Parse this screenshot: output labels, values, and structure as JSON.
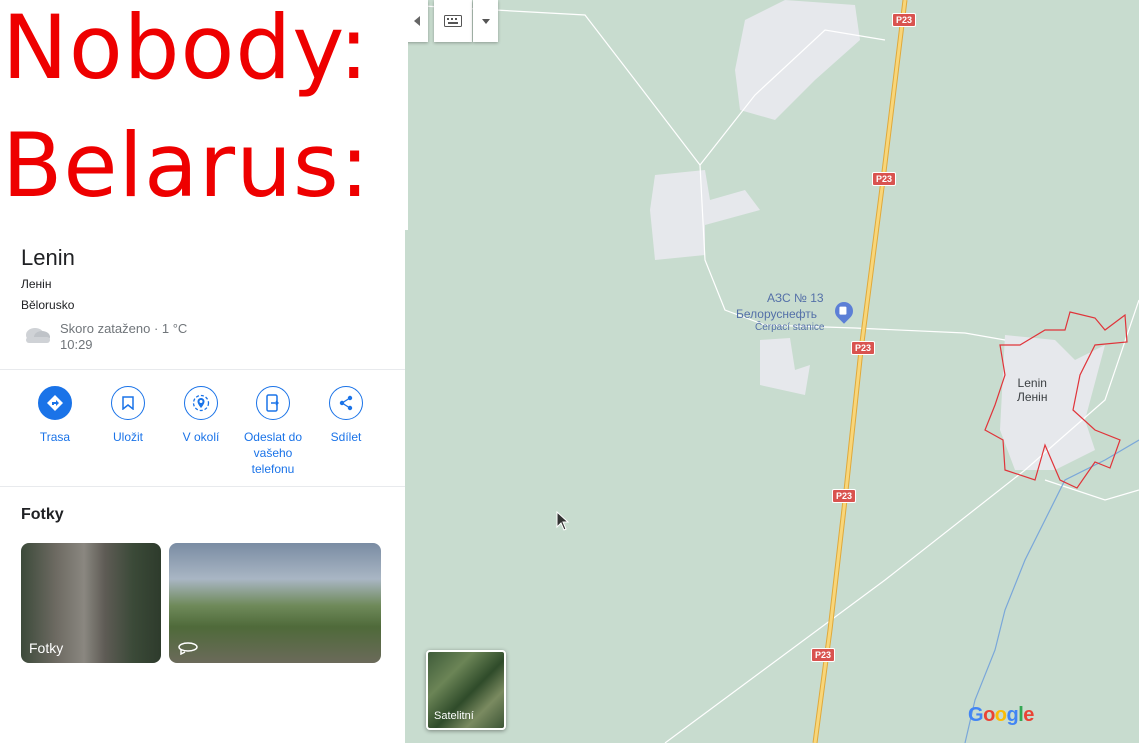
{
  "meme": {
    "line1": "Nobody:",
    "line2": "Belarus:"
  },
  "place": {
    "name": "Lenin",
    "native_name": "Ленін",
    "country": "Bělorusko",
    "weather_summary": "Skoro zataženo · 1 °C",
    "time": "10:29",
    "weather_icon": "cloud-icon"
  },
  "actions": [
    {
      "label": "Trasa",
      "icon": "directions-icon"
    },
    {
      "label": "Uložit",
      "icon": "bookmark-icon"
    },
    {
      "label": "V okolí",
      "icon": "nearby-icon"
    },
    {
      "label": "Odeslat do vašeho telefonu",
      "icon": "send-to-phone-icon"
    },
    {
      "label": "Sdílet",
      "icon": "share-icon"
    }
  ],
  "photos": {
    "title": "Fotky",
    "items": [
      {
        "caption": "Fotky"
      },
      {
        "caption": "",
        "icon": "360-view-icon"
      }
    ]
  },
  "map": {
    "road_shield": "P23",
    "poi_name": "АЗС № 13",
    "poi_brand": "Белоруснефть",
    "poi_type": "Čerpací stanice",
    "town_latin": "Lenin",
    "town_native": "Ленін",
    "satellite_label": "Satelitní",
    "logo": "Google",
    "colors": {
      "road": "#f2c35b",
      "boundary": "#e0343a",
      "accent": "#1a73e8",
      "shield": "#d9534f"
    }
  }
}
